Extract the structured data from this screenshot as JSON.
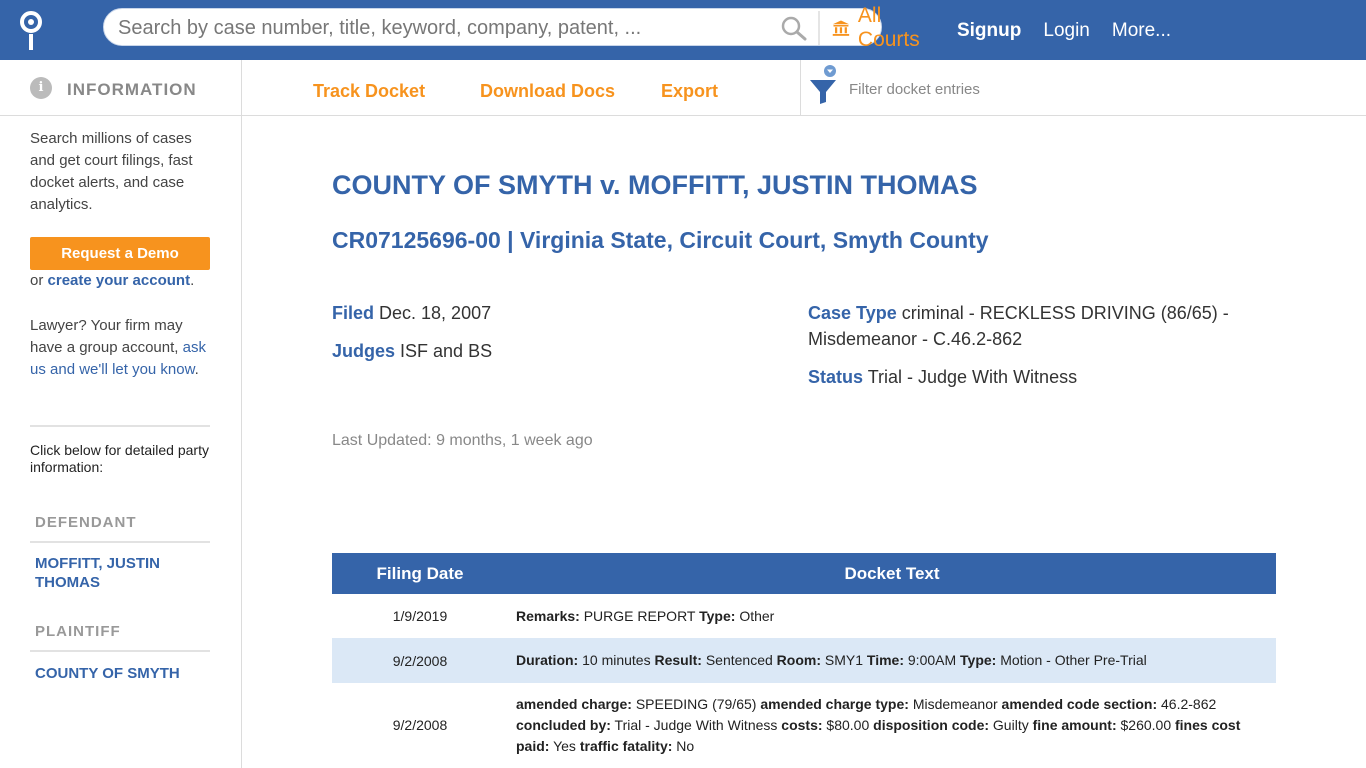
{
  "header": {
    "search_placeholder": "Search by case number, title, keyword, company, patent, ...",
    "courts_label": "All Courts",
    "nav": {
      "signup": "Signup",
      "login": "Login",
      "more": "More..."
    }
  },
  "sidebar": {
    "section_title": "INFORMATION",
    "info_icon_glyph": "i",
    "intro": "Search millions of cases and get court filings, fast docket alerts, and case analytics.",
    "demo_button": "Request a Demo",
    "or_text": "or ",
    "create_account_link": "create your account",
    "period": ".",
    "lawyer_text": "Lawyer? Your firm may have a group account, ",
    "ask_link": "ask us and we'll let you know",
    "click_below": "Click below for detailed party information:",
    "defendant_label": "DEFENDANT",
    "defendant_name": "MOFFITT, JUSTIN THOMAS",
    "plaintiff_label": "PLAINTIFF",
    "plaintiff_name": "COUNTY OF SMYTH"
  },
  "toolbar": {
    "track": "Track Docket",
    "download": "Download Docs",
    "export": "Export",
    "filter_placeholder": "Filter docket entries"
  },
  "case": {
    "title": "COUNTY OF SMYTH v. MOFFITT, JUSTIN THOMAS",
    "subtitle": "CR07125696-00 | Virginia State, Circuit Court, Smyth County",
    "filed_label": "Filed",
    "filed_value": " Dec. 18, 2007",
    "judges_label": "Judges",
    "judges_value": " ISF and BS",
    "case_type_label": "Case Type",
    "case_type_value": " criminal - RECKLESS DRIVING (86/65) - Misdemeanor - C.46.2-862",
    "status_label": "Status",
    "status_value": " Trial - Judge With Witness",
    "last_updated": "Last Updated: 9 months, 1 week ago"
  },
  "docket": {
    "headers": [
      "Filing Date",
      "Docket Text"
    ],
    "rows": [
      {
        "date": "1/9/2019",
        "parts": [
          {
            "k": "Remarks:",
            "v": " PURGE REPORT "
          },
          {
            "k": "Type:",
            "v": " Other"
          }
        ]
      },
      {
        "date": "9/2/2008",
        "parts": [
          {
            "k": "Duration:",
            "v": " 10 minutes "
          },
          {
            "k": "Result:",
            "v": " Sentenced "
          },
          {
            "k": "Room:",
            "v": " SMY1 "
          },
          {
            "k": "Time:",
            "v": " 9:00AM "
          },
          {
            "k": "Type:",
            "v": " Motion - Other Pre-Trial"
          }
        ]
      },
      {
        "date": "9/2/2008",
        "parts": [
          {
            "k": "amended charge:",
            "v": " SPEEDING (79/65) "
          },
          {
            "k": "amended charge type:",
            "v": " Misdemeanor "
          },
          {
            "k": "amended code section:",
            "v": " 46.2-862 "
          },
          {
            "k": "concluded by:",
            "v": " Trial - Judge With Witness "
          },
          {
            "k": "costs:",
            "v": " $80.00 "
          },
          {
            "k": "disposition code:",
            "v": " Guilty "
          },
          {
            "k": "fine amount:",
            "v": " $260.00 "
          },
          {
            "k": "fines cost paid:",
            "v": " Yes "
          },
          {
            "k": "traffic fatality:",
            "v": " No"
          }
        ]
      }
    ]
  },
  "colors": {
    "brand_blue": "#3564a9",
    "accent_orange": "#f7931e",
    "row_alt": "#dbe8f6"
  }
}
